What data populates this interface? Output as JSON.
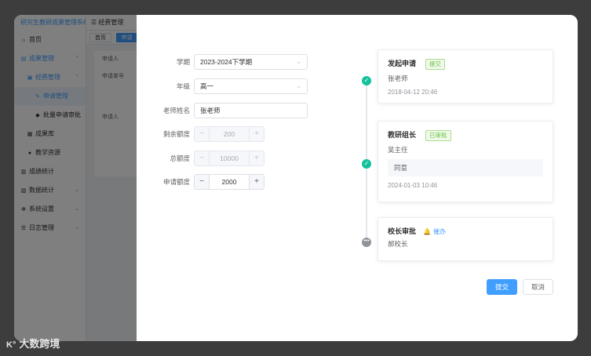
{
  "app": {
    "title": "研究生教研成果管理系统",
    "sidebar": [
      {
        "label": "首页",
        "icon": "home-icon"
      },
      {
        "label": "成果管理",
        "icon": "folder-icon"
      },
      {
        "label": "经费管理",
        "icon": "wallet-icon"
      },
      {
        "label": "申请管理",
        "icon": "edit-icon"
      },
      {
        "label": "批量申请审批",
        "icon": "shield-icon"
      },
      {
        "label": "成果库",
        "icon": "book-icon"
      },
      {
        "label": "教学资源",
        "icon": "user-icon"
      },
      {
        "label": "成绩统计",
        "icon": "chart-icon"
      },
      {
        "label": "数据统计",
        "icon": "stats-icon"
      },
      {
        "label": "系统设置",
        "icon": "gear-icon"
      },
      {
        "label": "日志管理",
        "icon": "list-icon"
      }
    ],
    "breadcrumb": "经费管理",
    "tabs": [
      "首页",
      "申请"
    ],
    "content_rows": [
      "申请人",
      "申请单号",
      "申请人"
    ]
  },
  "form": {
    "semester_label": "学期",
    "semester_value": "2023-2024下学期",
    "grade_label": "年级",
    "grade_value": "高一",
    "teacher_label": "老师姓名",
    "teacher_value": "张老师",
    "remaining_label": "剩余额度",
    "remaining_value": "200",
    "total_label": "总额度",
    "total_value": "10000",
    "apply_label": "申请额度",
    "apply_value": "2000"
  },
  "timeline": {
    "step1": {
      "title": "发起申请",
      "tag": "提交",
      "person": "张老师",
      "time": "2018-04-12 20:46"
    },
    "step2": {
      "title": "教研组长",
      "tag": "已审批",
      "person": "吴主任",
      "comment": "同意",
      "time": "2024-01-03 10:46"
    },
    "step3": {
      "title": "校长审批",
      "remind": "催办",
      "person": "郝校长"
    }
  },
  "actions": {
    "submit": "提交",
    "cancel": "取消"
  },
  "watermark": "大数跨境",
  "colors": {
    "primary": "#409eff",
    "success": "#13c29c",
    "tag_green": "#67c23a",
    "pending": "#909399"
  }
}
